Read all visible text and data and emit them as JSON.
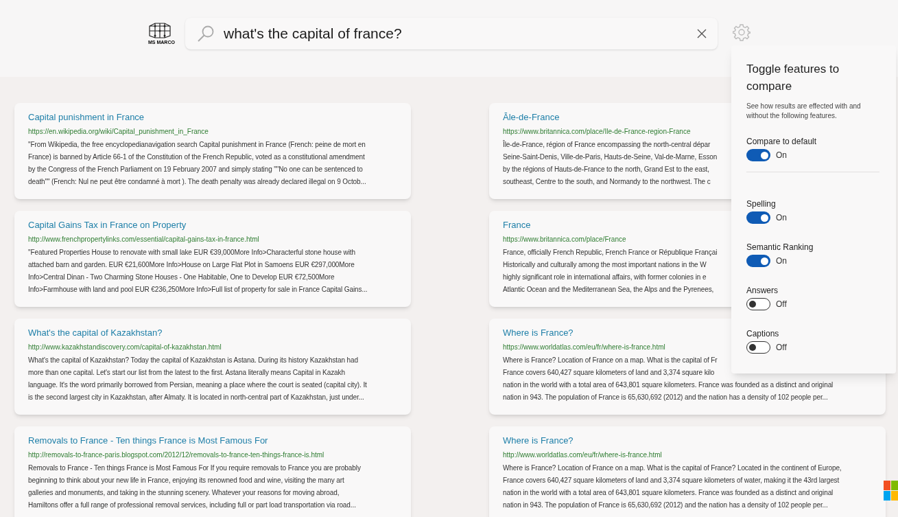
{
  "header": {
    "logo_text": "MS MARCO",
    "search": {
      "value": "what's the capital of france?"
    }
  },
  "results": [
    {
      "title": "Capital punishment in France",
      "url": "https://en.wikipedia.org/wiki/Capital_punishment_in_France",
      "lines": [
        "\"From Wikipedia, the free encyclopedianavigation search Capital punishment in France (French: peine de mort en",
        "France) is banned by Article 66-1 of the Constitution of the French Republic, voted as a constitutional amendment",
        "by the Congress of the French Parliament on 19 February 2007 and simply stating \"\"No one can be sentenced to",
        "death\"\" (French: Nul ne peut être condamné à mort ). The death penalty was already declared illegal on 9 Octob..."
      ]
    },
    {
      "title": "Āle-de-France",
      "url": "https://www.britannica.com/place/Ile-de-France-region-France",
      "lines": [
        "Île-de-France, région of France encompassing the north-central dépar",
        "Seine-Saint-Denis, Ville-de-Paris, Hauts-de-Seine, Val-de-Marne, Esson",
        "by the régions of Hauts-de-France to the north, Grand Est to the east,",
        "southeast, Centre to the south, and Normandy to the northwest. The c"
      ]
    },
    {
      "title": "Capital Gains Tax in France on Property",
      "url": "http://www.frenchpropertylinks.com/essential/capital-gains-tax-in-france.html",
      "lines": [
        "\"Featured Properties House to renovate with small lake EUR €39,000More Info>Characterful stone house with",
        "attached barn and garden. EUR €21,600More Info>House on Large Flat Plot in Samoens EUR €297,000More",
        "Info>Central Dinan - Two Charming Stone Houses - One Habitable, One to Develop EUR €72,500More",
        "Info>Farmhouse with land and pool EUR €236,250More Info>Full list of property for sale in France Capital Gains..."
      ]
    },
    {
      "title": "France",
      "url": "https://www.britannica.com/place/France",
      "lines": [
        "France, officially French Republic, French France or République Françai",
        "Historically and culturally among the most important nations in the W",
        "highly significant role in international affairs, with former colonies in e",
        "Atlantic Ocean and the Mediterranean Sea, the Alps and the Pyrenees,"
      ]
    },
    {
      "title": "What's the capital of Kazakhstan?",
      "url": "http://www.kazakhstandiscovery.com/capital-of-kazakhstan.html",
      "lines": [
        "What's the capital of Kazakhstan? Today the capital of Kazakhstan is Astana. During its history Kazakhstan had",
        "more than one capital. Let's start our list from the latest to the first. Astana literally means Capital in Kazakh",
        "language. It's the word primarily borrowed from Persian, meaning a place where the court is seated (capital city). It",
        "is the second largest city in Kazakhstan, after Almaty. It is located in north-central part of Kazakhstan, just under..."
      ]
    },
    {
      "title": "Where is France?",
      "url": "https://www.worldatlas.com/eu/fr/where-is-france.html",
      "lines": [
        "Where is France? Location of France on a map. What is the capital of Fr",
        "France covers 640,427 square kilometers of land and 3,374 square kilo",
        "nation in the world with a total area of 643,801 square kilometers. France was founded as a distinct and original",
        "nation in 943. The population of France is 65,630,692 (2012) and the nation has a density of 102 people per..."
      ]
    },
    {
      "title": "Removals to France - Ten things France is Most Famous For",
      "url": "http://removals-to-france-paris.blogspot.com/2012/12/removals-to-france-ten-things-france-is.html",
      "lines": [
        "Removals to France - Ten things France is Most Famous For If you require removals to France you are probably",
        "beginning to think about your new life in France, enjoying its renowned food and wine, visiting the many art",
        "galleries and monuments, and taking in the stunning scenery. Whatever your reasons for moving abroad,",
        "Hamiltons offer a full range of professional removal services, including full or part load transportation via road..."
      ]
    },
    {
      "title": "Where is France?",
      "url": "http://www.worldatlas.com/eu/fr/where-is-france.html",
      "lines": [
        "Where is France? Location of France on a map. What is the capital of France? Located in the continent of Europe,",
        "France covers 640,427 square kilometers of land and 3,374 square kilometers of water, making it the 43rd largest",
        "nation in the world with a total area of 643,801 square kilometers. France was founded as a distinct and original",
        "nation in 943. The population of France is 65,630,692 (2012) and the nation has a density of 102 people per..."
      ]
    }
  ],
  "panel": {
    "title": "Toggle features to compare",
    "description": "See how results are effected with and without the following features.",
    "toggles": [
      {
        "label": "Compare to default",
        "on": true,
        "state_text": "On"
      },
      {
        "label": "Spelling",
        "on": true,
        "state_text": "On"
      },
      {
        "label": "Semantic Ranking",
        "on": true,
        "state_text": "On"
      },
      {
        "label": "Answers",
        "on": false,
        "state_text": "Off"
      },
      {
        "label": "Captions",
        "on": false,
        "state_text": "Off"
      }
    ]
  }
}
